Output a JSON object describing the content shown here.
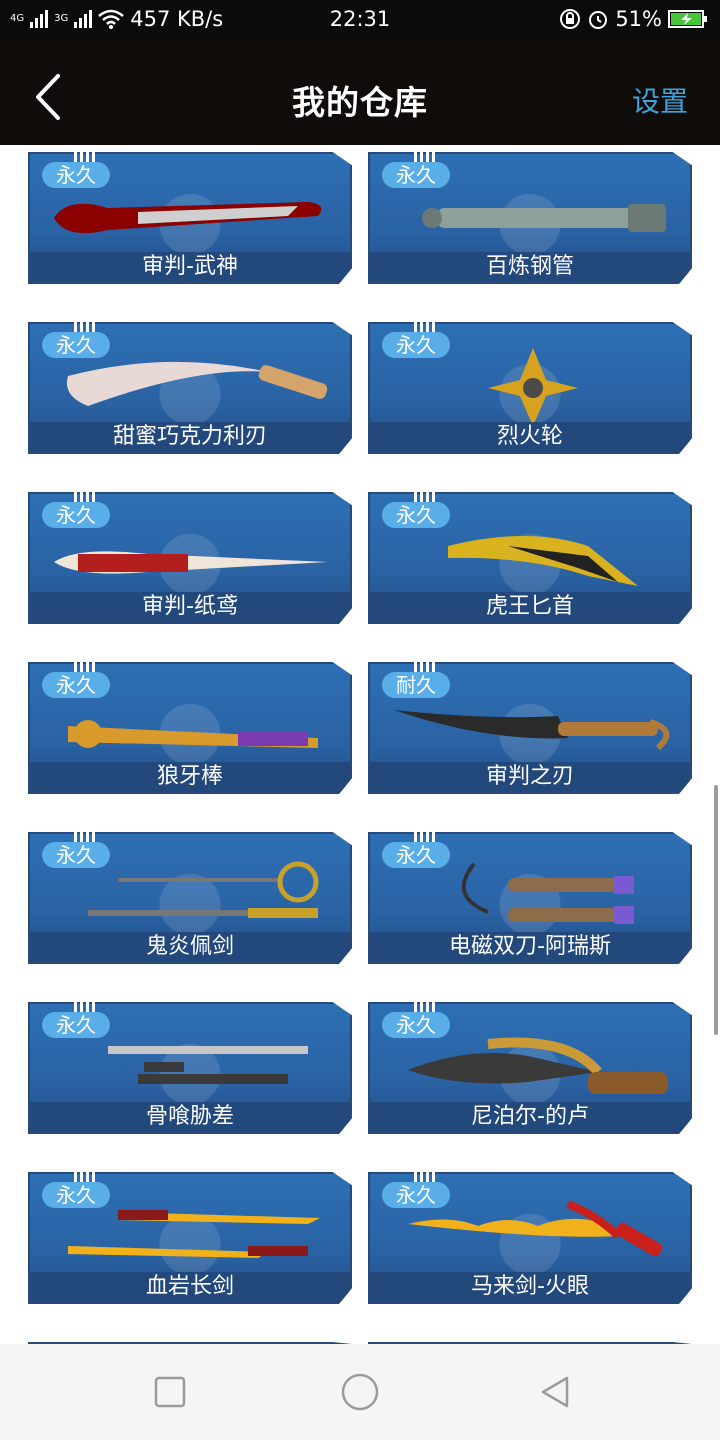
{
  "status_bar": {
    "net_left": "4G",
    "net_right": "3G",
    "speed": "457 KB/s",
    "time": "22:31",
    "battery": "51%"
  },
  "header": {
    "title": "我的仓库",
    "settings_label": "设置"
  },
  "items": [
    {
      "badge": "永久",
      "name": "审判-武神",
      "colors": [
        "#8b0000",
        "#cfcfcf"
      ]
    },
    {
      "badge": "永久",
      "name": "百炼钢管",
      "colors": [
        "#8ea09a",
        "#6c7a75"
      ]
    },
    {
      "badge": "永久",
      "name": "甜蜜巧克力利刃",
      "colors": [
        "#e9d9d6",
        "#d4a46a"
      ]
    },
    {
      "badge": "永久",
      "name": "烈火轮",
      "colors": [
        "#d6a21f",
        "#4b4b4b"
      ]
    },
    {
      "badge": "永久",
      "name": "审判-纸鸢",
      "colors": [
        "#b31f1f",
        "#efe6d8"
      ]
    },
    {
      "badge": "永久",
      "name": "虎王匕首",
      "colors": [
        "#d8b21f",
        "#222222"
      ]
    },
    {
      "badge": "永久",
      "name": "狼牙棒",
      "colors": [
        "#d89a2a",
        "#7a3ab0"
      ]
    },
    {
      "badge": "耐久",
      "name": "审判之刃",
      "colors": [
        "#2a2a2a",
        "#b07a3a"
      ]
    },
    {
      "badge": "永久",
      "name": "鬼炎佩剑",
      "colors": [
        "#c8a12b",
        "#777777"
      ]
    },
    {
      "badge": "永久",
      "name": "电磁双刀-阿瑞斯",
      "colors": [
        "#8c6c4a",
        "#7a5ad0"
      ]
    },
    {
      "badge": "永久",
      "name": "骨喰胁差",
      "colors": [
        "#c7c7c7",
        "#3a3a3a"
      ]
    },
    {
      "badge": "永久",
      "name": "尼泊尔-的卢",
      "colors": [
        "#c99a35",
        "#8a5a2a"
      ]
    },
    {
      "badge": "永久",
      "name": "血岩长剑",
      "colors": [
        "#f0b11a",
        "#8a1a1a"
      ]
    },
    {
      "badge": "永久",
      "name": "马来剑-火眼",
      "colors": [
        "#f0b11a",
        "#c9201a"
      ]
    }
  ],
  "nav": {
    "recent_icon": "square-icon",
    "home_icon": "circle-icon",
    "back_icon": "triangle-back-icon"
  }
}
